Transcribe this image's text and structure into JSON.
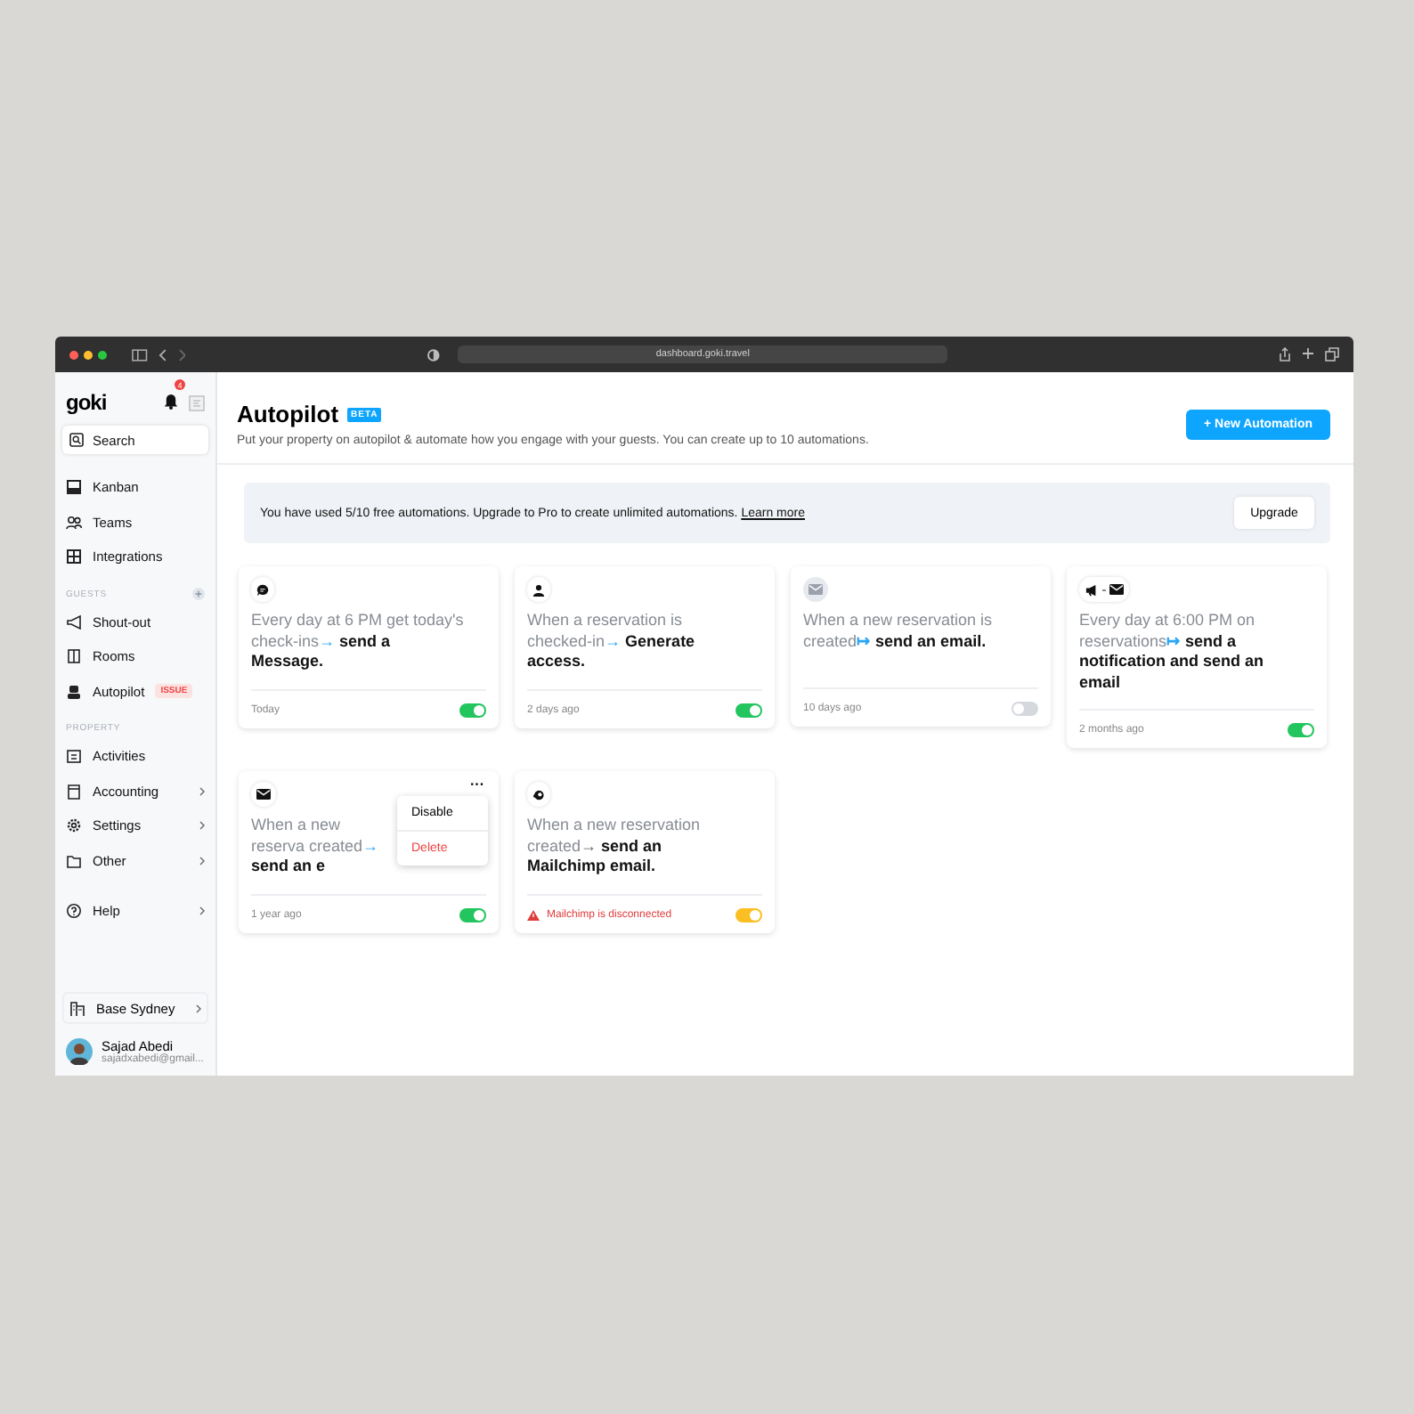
{
  "browser": {
    "url": "dashboard.goki.travel"
  },
  "sidebar": {
    "logo": "goki",
    "notifications": "4",
    "search": {
      "placeholder": "Search"
    },
    "sections": [
      {
        "items": [
          {
            "label": "Kanban"
          },
          {
            "label": "Teams"
          },
          {
            "label": "Integrations"
          }
        ]
      },
      {
        "label": "GUESTS",
        "add": true,
        "items": [
          {
            "label": "Shout-out"
          },
          {
            "label": "Rooms"
          },
          {
            "label": "Autopilot",
            "badge": "ISSUE"
          }
        ]
      },
      {
        "label": "PROPERTY",
        "items": [
          {
            "label": "Activities"
          },
          {
            "label": "Accounting",
            "chevron": true
          },
          {
            "label": "Settings",
            "chevron": true
          },
          {
            "label": "Other",
            "chevron": true
          }
        ]
      },
      {
        "items": [
          {
            "label": "Help",
            "chevron": true
          }
        ]
      }
    ],
    "property": "Base Sydney",
    "user": {
      "name": "Sajad Abedi",
      "email": "sajadxabedi@gmail..."
    }
  },
  "header": {
    "title": "Autopilot",
    "badge": "BETA",
    "subtitle": "Put your property on autopilot & automate how you engage with your guests. You can create up to 10 automations.",
    "button": "+ New Automation"
  },
  "banner": {
    "text": "You have used 5/10 free automations. Upgrade to Pro to create unlimited automations.",
    "link": "Learn more",
    "button": "Upgrade"
  },
  "cards": [
    {
      "trigger": "Every day at 6 PM get today's check-ins",
      "arrow": "→",
      "action": "send a Message.",
      "time": "Today",
      "on": true
    },
    {
      "trigger": "When a reservation is checked-in",
      "arrow": "→",
      "action": "Generate access.",
      "time": "2 days ago",
      "on": true
    },
    {
      "trigger": "When a new reservation is created",
      "arrow": "↦",
      "action": "send an email.",
      "time": "10 days ago",
      "on": false
    },
    {
      "trigger": "Every day at 6:00 PM on reservations",
      "arrow": "↦",
      "action": "send a notification and send an email",
      "time": "2 months ago",
      "on": true
    },
    {
      "trigger": "When a new reserva created",
      "arrow": "→",
      "action": "send an e",
      "time": "1 year ago",
      "on": true,
      "more": "···",
      "menu": [
        {
          "label": "Disable",
          "kind": "normal"
        },
        {
          "label": "Delete",
          "kind": "danger"
        }
      ]
    },
    {
      "trigger": "When a new reservation created",
      "arrow": "→",
      "action": "send an Mailchimp email.",
      "alert": "Mailchimp is disconnected",
      "on": true
    }
  ]
}
